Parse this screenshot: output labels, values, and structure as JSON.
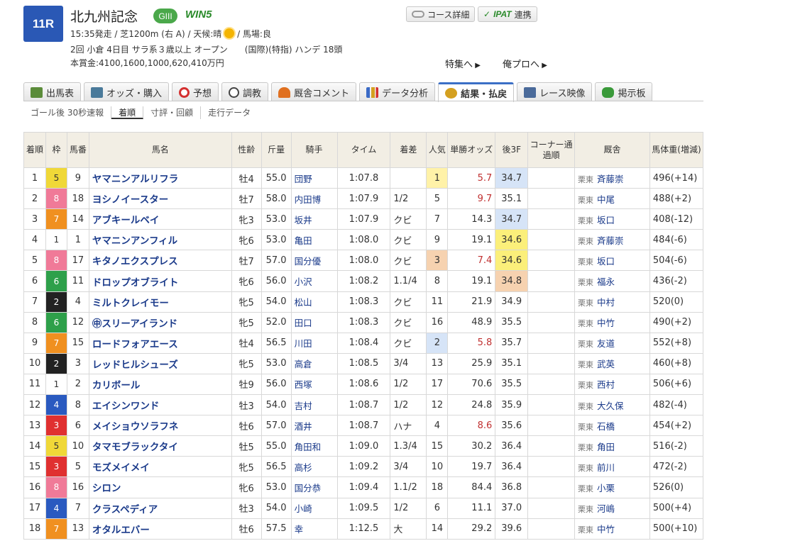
{
  "race": {
    "number": "11R",
    "name": "北九州記念",
    "grade": "GIII",
    "win5": "WIN5",
    "line1_a": "15:35発走 / 芝1200m (右 A) / 天候:晴",
    "line1_b": "/ 馬場:良",
    "line2": "2回 小倉 4日目 サラ系３歳以上 オープン　　(国際)(特指) ハンデ 18頭",
    "line3": "本賞金:4100,1600,1000,620,410万円"
  },
  "header_buttons": {
    "course": "コース詳細",
    "ipat_logo": "IPAT",
    "ipat": "連携"
  },
  "links": {
    "special": "特集へ",
    "ore_pro": "俺プロへ"
  },
  "tabs": [
    {
      "label": "出馬表",
      "icon": "table-icon",
      "color": "#5b8c3a"
    },
    {
      "label": "オッズ・購入",
      "icon": "odds-icon",
      "color": "#4a7a9a"
    },
    {
      "label": "予想",
      "icon": "target-icon",
      "color": "#d43030"
    },
    {
      "label": "調教",
      "icon": "stopwatch-icon",
      "color": "#444444"
    },
    {
      "label": "厩舎コメント",
      "icon": "stable-icon",
      "color": "#e07020"
    },
    {
      "label": "データ分析",
      "icon": "bar-chart-icon",
      "color": "#3a6ac6"
    },
    {
      "label": "結果・払戻",
      "icon": "coins-icon",
      "color": "#d4a020"
    },
    {
      "label": "レース映像",
      "icon": "video-icon",
      "color": "#4a6a9a"
    },
    {
      "label": "掲示板",
      "icon": "chat-icon",
      "color": "#3a9a3a"
    }
  ],
  "subtabs": [
    "ゴール後 30秒速報",
    "着順",
    "寸評・回顧",
    "走行データ"
  ],
  "table": {
    "headers": {
      "rank": "着順",
      "waku": "枠",
      "num": "馬番",
      "name": "馬名",
      "sexage": "性齢",
      "weight": "斤量",
      "jockey": "騎手",
      "time": "タイム",
      "margin": "着差",
      "pop": "人気",
      "odds": "単勝オッズ",
      "last3f": "後3F",
      "corner": "コーナー通過順",
      "trainer": "厩舎",
      "bodyweight": "馬体重(増減)"
    },
    "waku_colors": {
      "1": {
        "bg": "#ffffff",
        "fg": "#333333"
      },
      "2": {
        "bg": "#222222",
        "fg": "#ffffff"
      },
      "3": {
        "bg": "#e03030",
        "fg": "#ffffff"
      },
      "4": {
        "bg": "#2a5ac0",
        "fg": "#ffffff"
      },
      "5": {
        "bg": "#f0d838",
        "fg": "#333333"
      },
      "6": {
        "bg": "#2ea04a",
        "fg": "#ffffff"
      },
      "7": {
        "bg": "#f09020",
        "fg": "#ffffff"
      },
      "8": {
        "bg": "#f07a98",
        "fg": "#ffffff"
      }
    },
    "rows": [
      {
        "rank": "1",
        "waku": "5",
        "num": "9",
        "name": "ヤマニンアルリフラ",
        "sexage": "牡4",
        "weight": "55.0",
        "jockey": "団野",
        "time": "1:07.8",
        "margin": "",
        "pop": "1",
        "odds": "5.7",
        "last3f": "34.7",
        "region": "栗東",
        "trainer": "斉藤崇",
        "bw": "496(+14)",
        "pop_hl": "pop1",
        "odds_hl": true,
        "f_hl": "f2"
      },
      {
        "rank": "2",
        "waku": "8",
        "num": "18",
        "name": "ヨシノイースター",
        "sexage": "牡7",
        "weight": "58.0",
        "jockey": "内田博",
        "time": "1:07.9",
        "margin": "1/2",
        "pop": "5",
        "odds": "9.7",
        "last3f": "35.1",
        "region": "栗東",
        "trainer": "中尾",
        "bw": "488(+2)",
        "pop_hl": "",
        "odds_hl": true,
        "f_hl": ""
      },
      {
        "rank": "3",
        "waku": "7",
        "num": "14",
        "name": "アブキールベイ",
        "sexage": "牝3",
        "weight": "53.0",
        "jockey": "坂井",
        "time": "1:07.9",
        "margin": "クビ",
        "pop": "7",
        "odds": "14.3",
        "last3f": "34.7",
        "region": "栗東",
        "trainer": "坂口",
        "bw": "408(-12)",
        "pop_hl": "",
        "odds_hl": false,
        "f_hl": "f2"
      },
      {
        "rank": "4",
        "waku": "1",
        "num": "1",
        "name": "ヤマニンアンフィル",
        "sexage": "牝6",
        "weight": "53.0",
        "jockey": "亀田",
        "time": "1:08.0",
        "margin": "クビ",
        "pop": "9",
        "odds": "19.1",
        "last3f": "34.6",
        "region": "栗東",
        "trainer": "斉藤崇",
        "bw": "484(-6)",
        "pop_hl": "",
        "odds_hl": false,
        "f_hl": "f1"
      },
      {
        "rank": "5",
        "waku": "8",
        "num": "17",
        "name": "キタノエクスプレス",
        "sexage": "牡7",
        "weight": "57.0",
        "jockey": "国分優",
        "time": "1:08.0",
        "margin": "クビ",
        "pop": "3",
        "odds": "7.4",
        "last3f": "34.6",
        "region": "栗東",
        "trainer": "坂口",
        "bw": "504(-6)",
        "pop_hl": "pop3",
        "odds_hl": true,
        "f_hl": "f1"
      },
      {
        "rank": "6",
        "waku": "6",
        "num": "11",
        "name": "ドロップオブライト",
        "sexage": "牝6",
        "weight": "56.0",
        "jockey": "小沢",
        "time": "1:08.2",
        "margin": "1.1/4",
        "pop": "8",
        "odds": "19.1",
        "last3f": "34.8",
        "region": "栗東",
        "trainer": "福永",
        "bw": "436(-2)",
        "pop_hl": "",
        "odds_hl": false,
        "f_hl": "f3"
      },
      {
        "rank": "7",
        "waku": "2",
        "num": "4",
        "name": "ミルトクレイモー",
        "sexage": "牝5",
        "weight": "54.0",
        "jockey": "松山",
        "time": "1:08.3",
        "margin": "クビ",
        "pop": "11",
        "odds": "21.9",
        "last3f": "34.9",
        "region": "栗東",
        "trainer": "中村",
        "bw": "520(0)",
        "pop_hl": "",
        "odds_hl": false,
        "f_hl": ""
      },
      {
        "rank": "8",
        "waku": "6",
        "num": "12",
        "name": "㊥スリーアイランド",
        "sexage": "牝5",
        "weight": "52.0",
        "jockey": "田口",
        "time": "1:08.3",
        "margin": "クビ",
        "pop": "16",
        "odds": "48.9",
        "last3f": "35.5",
        "region": "栗東",
        "trainer": "中竹",
        "bw": "490(+2)",
        "pop_hl": "",
        "odds_hl": false,
        "f_hl": ""
      },
      {
        "rank": "9",
        "waku": "7",
        "num": "15",
        "name": "ロードフォアエース",
        "sexage": "牡4",
        "weight": "56.5",
        "jockey": "川田",
        "time": "1:08.4",
        "margin": "クビ",
        "pop": "2",
        "odds": "5.8",
        "last3f": "35.7",
        "region": "栗東",
        "trainer": "友道",
        "bw": "552(+8)",
        "pop_hl": "pop2",
        "odds_hl": true,
        "f_hl": ""
      },
      {
        "rank": "10",
        "waku": "2",
        "num": "3",
        "name": "レッドヒルシューズ",
        "sexage": "牝5",
        "weight": "53.0",
        "jockey": "高倉",
        "time": "1:08.5",
        "margin": "3/4",
        "pop": "13",
        "odds": "25.9",
        "last3f": "35.1",
        "region": "栗東",
        "trainer": "武英",
        "bw": "460(+8)",
        "pop_hl": "",
        "odds_hl": false,
        "f_hl": ""
      },
      {
        "rank": "11",
        "waku": "1",
        "num": "2",
        "name": "カリボール",
        "sexage": "牡9",
        "weight": "56.0",
        "jockey": "西塚",
        "time": "1:08.6",
        "margin": "1/2",
        "pop": "17",
        "odds": "70.6",
        "last3f": "35.5",
        "region": "栗東",
        "trainer": "西村",
        "bw": "506(+6)",
        "pop_hl": "",
        "odds_hl": false,
        "f_hl": ""
      },
      {
        "rank": "12",
        "waku": "4",
        "num": "8",
        "name": "エイシンワンド",
        "sexage": "牡3",
        "weight": "54.0",
        "jockey": "吉村",
        "time": "1:08.7",
        "margin": "1/2",
        "pop": "12",
        "odds": "24.8",
        "last3f": "35.9",
        "region": "栗東",
        "trainer": "大久保",
        "bw": "482(-4)",
        "pop_hl": "",
        "odds_hl": false,
        "f_hl": ""
      },
      {
        "rank": "13",
        "waku": "3",
        "num": "6",
        "name": "メイショウソラフネ",
        "sexage": "牡6",
        "weight": "57.0",
        "jockey": "酒井",
        "time": "1:08.7",
        "margin": "ハナ",
        "pop": "4",
        "odds": "8.6",
        "last3f": "35.6",
        "region": "栗東",
        "trainer": "石橋",
        "bw": "454(+2)",
        "pop_hl": "",
        "odds_hl": true,
        "f_hl": ""
      },
      {
        "rank": "14",
        "waku": "5",
        "num": "10",
        "name": "タマモブラックタイ",
        "sexage": "牡5",
        "weight": "55.0",
        "jockey": "角田和",
        "time": "1:09.0",
        "margin": "1.3/4",
        "pop": "15",
        "odds": "30.2",
        "last3f": "36.4",
        "region": "栗東",
        "trainer": "角田",
        "bw": "516(-2)",
        "pop_hl": "",
        "odds_hl": false,
        "f_hl": ""
      },
      {
        "rank": "15",
        "waku": "3",
        "num": "5",
        "name": "モズメイメイ",
        "sexage": "牝5",
        "weight": "56.5",
        "jockey": "高杉",
        "time": "1:09.2",
        "margin": "3/4",
        "pop": "10",
        "odds": "19.7",
        "last3f": "36.4",
        "region": "栗東",
        "trainer": "前川",
        "bw": "472(-2)",
        "pop_hl": "",
        "odds_hl": false,
        "f_hl": ""
      },
      {
        "rank": "16",
        "waku": "8",
        "num": "16",
        "name": "シロン",
        "sexage": "牝6",
        "weight": "53.0",
        "jockey": "国分恭",
        "time": "1:09.4",
        "margin": "1.1/2",
        "pop": "18",
        "odds": "84.4",
        "last3f": "36.8",
        "region": "栗東",
        "trainer": "小栗",
        "bw": "526(0)",
        "pop_hl": "",
        "odds_hl": false,
        "f_hl": ""
      },
      {
        "rank": "17",
        "waku": "4",
        "num": "7",
        "name": "クラスペディア",
        "sexage": "牡3",
        "weight": "54.0",
        "jockey": "小崎",
        "time": "1:09.5",
        "margin": "1/2",
        "pop": "6",
        "odds": "11.1",
        "last3f": "37.0",
        "region": "栗東",
        "trainer": "河嶋",
        "bw": "500(+4)",
        "pop_hl": "",
        "odds_hl": false,
        "f_hl": ""
      },
      {
        "rank": "18",
        "waku": "7",
        "num": "13",
        "name": "オタルエバー",
        "sexage": "牡6",
        "weight": "57.5",
        "jockey": "幸",
        "time": "1:12.5",
        "margin": "大",
        "pop": "14",
        "odds": "29.2",
        "last3f": "39.6",
        "region": "栗東",
        "trainer": "中竹",
        "bw": "500(+10)",
        "pop_hl": "",
        "odds_hl": false,
        "f_hl": ""
      }
    ]
  }
}
